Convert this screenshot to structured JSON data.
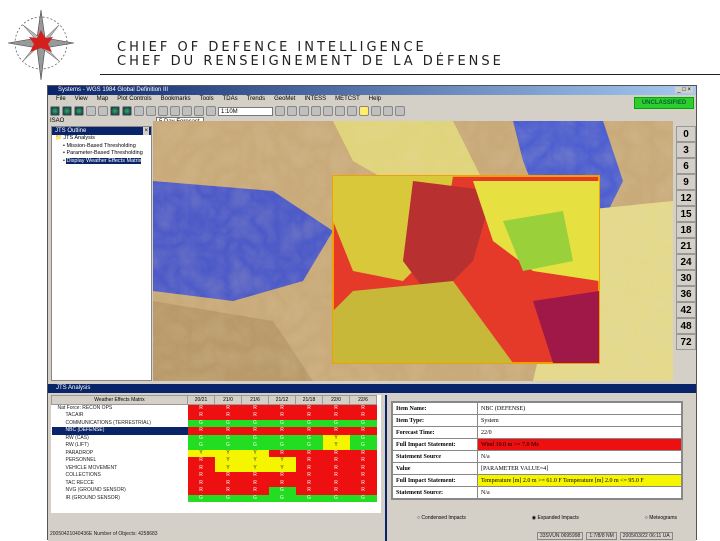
{
  "slide": {
    "line1": "CHIEF OF DEFENCE INTELLIGENCE",
    "line2": "CHEF DU RENSEIGNEMENT DE LA DÉFENSE"
  },
  "window": {
    "title": "Systems - WGS 1984 Global Definition III",
    "menu": [
      "File",
      "View",
      "Map",
      "Plot Controls",
      "Bookmarks",
      "Tools",
      "TDAs",
      "Trends",
      "GeoMet",
      "INTESS",
      "METCST",
      "Help"
    ],
    "scale_value": "1:10M",
    "region": "ISAO",
    "forecast": "5 Day Forecast",
    "classification": "UNCLASSIFIED"
  },
  "outline": {
    "title": "JTS Outline",
    "root": "JTS Analysis",
    "items": [
      "Mission-Based Thresholding",
      "Parameter-Based Thresholding",
      "Display Weather Effects Matrix"
    ]
  },
  "time_scale": [
    "0",
    "3",
    "6",
    "9",
    "12",
    "15",
    "18",
    "21",
    "24",
    "30",
    "36",
    "42",
    "48",
    "72"
  ],
  "analysis": {
    "title": "JTS Analysis",
    "matrix_header": "Weather Effects Matrix",
    "columns": [
      "20/21",
      "21/0",
      "21/6",
      "21/12",
      "21/18",
      "22/0",
      "22/6"
    ],
    "rows": [
      {
        "label": "Nat Force: RECON OPS",
        "cells": [
          "R",
          "R",
          "R",
          "R",
          "R",
          "R",
          "R"
        ]
      },
      {
        "label": "TACAIR",
        "cells": [
          "R",
          "R",
          "R",
          "R",
          "R",
          "R",
          "R"
        ]
      },
      {
        "label": "COMMUNICATIONS (TERRESTRIAL)",
        "cells": [
          "G",
          "G",
          "G",
          "G",
          "G",
          "G",
          "G"
        ]
      },
      {
        "label": "NBC (DEFENSE)",
        "cells": [
          "R",
          "R",
          "R",
          "R",
          "R",
          "R",
          "R"
        ]
      },
      {
        "label": "RW (CAS)",
        "cells": [
          "G",
          "G",
          "G",
          "G",
          "G",
          "Y",
          "G"
        ]
      },
      {
        "label": "RW (LIFT)",
        "cells": [
          "G",
          "G",
          "G",
          "G",
          "G",
          "Y",
          "G"
        ]
      },
      {
        "label": "PARADROP",
        "cells": [
          "Y",
          "Y",
          "Y",
          "R",
          "R",
          "R",
          "R"
        ]
      },
      {
        "label": "PERSONNEL",
        "cells": [
          "R",
          "Y",
          "Y",
          "Y",
          "R",
          "R",
          "R"
        ]
      },
      {
        "label": "VEHICLE MOVEMENT",
        "cells": [
          "R",
          "Y",
          "Y",
          "Y",
          "R",
          "R",
          "R"
        ]
      },
      {
        "label": "COLLECTIONS",
        "cells": [
          "R",
          "R",
          "R",
          "R",
          "R",
          "R",
          "R"
        ]
      },
      {
        "label": "TAC RECCE",
        "cells": [
          "R",
          "R",
          "R",
          "R",
          "R",
          "R",
          "R"
        ]
      },
      {
        "label": "NVG (GROUND SENSOR)",
        "cells": [
          "R",
          "R",
          "R",
          "G",
          "R",
          "R",
          "R"
        ]
      },
      {
        "label": "IR (GROUND SENSOR)",
        "cells": [
          "G",
          "G",
          "G",
          "G",
          "G",
          "G",
          "G"
        ]
      }
    ],
    "status_left": "20050421040436E Number of Objects: 4258683",
    "details": [
      {
        "k": "Item Name:",
        "v": "NBC (DEFENSE)",
        "c": ""
      },
      {
        "k": "Item Type:",
        "v": "System",
        "c": ""
      },
      {
        "k": "Forecast Time:",
        "v": "22/0",
        "c": ""
      },
      {
        "k": "Full Impact Statement:",
        "v": "Wind 10.0 m >= 7.0 Ms",
        "c": "#ee1010"
      },
      {
        "k": "Statement Source",
        "v": "N/a",
        "c": ""
      },
      {
        "k": "Value",
        "v": "[PARAMETER VALUE=4]",
        "c": ""
      },
      {
        "k": "Full Impact Statement:",
        "v": "Temperature [m] 2.0 m >= 61.0 F Temperature [m] 2.0 m <= 95.0 F",
        "c": "#f5f500"
      },
      {
        "k": "Statement Source:",
        "v": "N/a",
        "c": ""
      }
    ],
    "radios": [
      {
        "label": "Condensed Impacts",
        "checked": false
      },
      {
        "label": "Expanded Impacts",
        "checked": true
      },
      {
        "label": "Meteograms",
        "checked": false
      }
    ],
    "status_right": [
      "33SVUN 0695998",
      "1:7/8/8 NM",
      "2005/03/22 06:11 UA"
    ]
  }
}
